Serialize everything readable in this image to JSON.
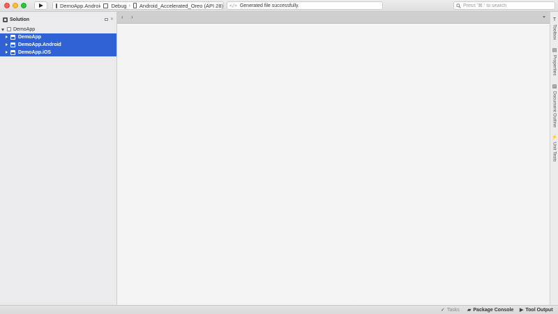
{
  "toolbar": {
    "run_label": "",
    "project": "DemoApp.Android",
    "configuration": "Debug",
    "device": "Android_Accelerated_Oreo (API 28)",
    "status_message": "Generated file successfully.",
    "search_placeholder": "Press '⌘.' to search"
  },
  "solution_pad": {
    "title": "Solution",
    "root": "DemoApp",
    "projects": [
      {
        "label": "DemoApp"
      },
      {
        "label": "DemoApp.Android"
      },
      {
        "label": "DemoApp.iOS"
      }
    ]
  },
  "right_rail": {
    "items": [
      {
        "label": "Toolbox",
        "icon": "toolbox-icon"
      },
      {
        "label": "Properties",
        "icon": "properties-icon"
      },
      {
        "label": "Document Outline",
        "icon": "document-outline-icon"
      },
      {
        "label": "Unit Tests",
        "icon": "unit-tests-icon"
      }
    ]
  },
  "bottom_bar": {
    "tasks": "Tasks",
    "package_console": "Package Console",
    "tool_output": "Tool Output"
  },
  "colors": {
    "selection": "#2f62d4",
    "traffic_close": "#fe5f57",
    "traffic_minimize": "#febc2e",
    "traffic_maximize": "#28c840"
  }
}
